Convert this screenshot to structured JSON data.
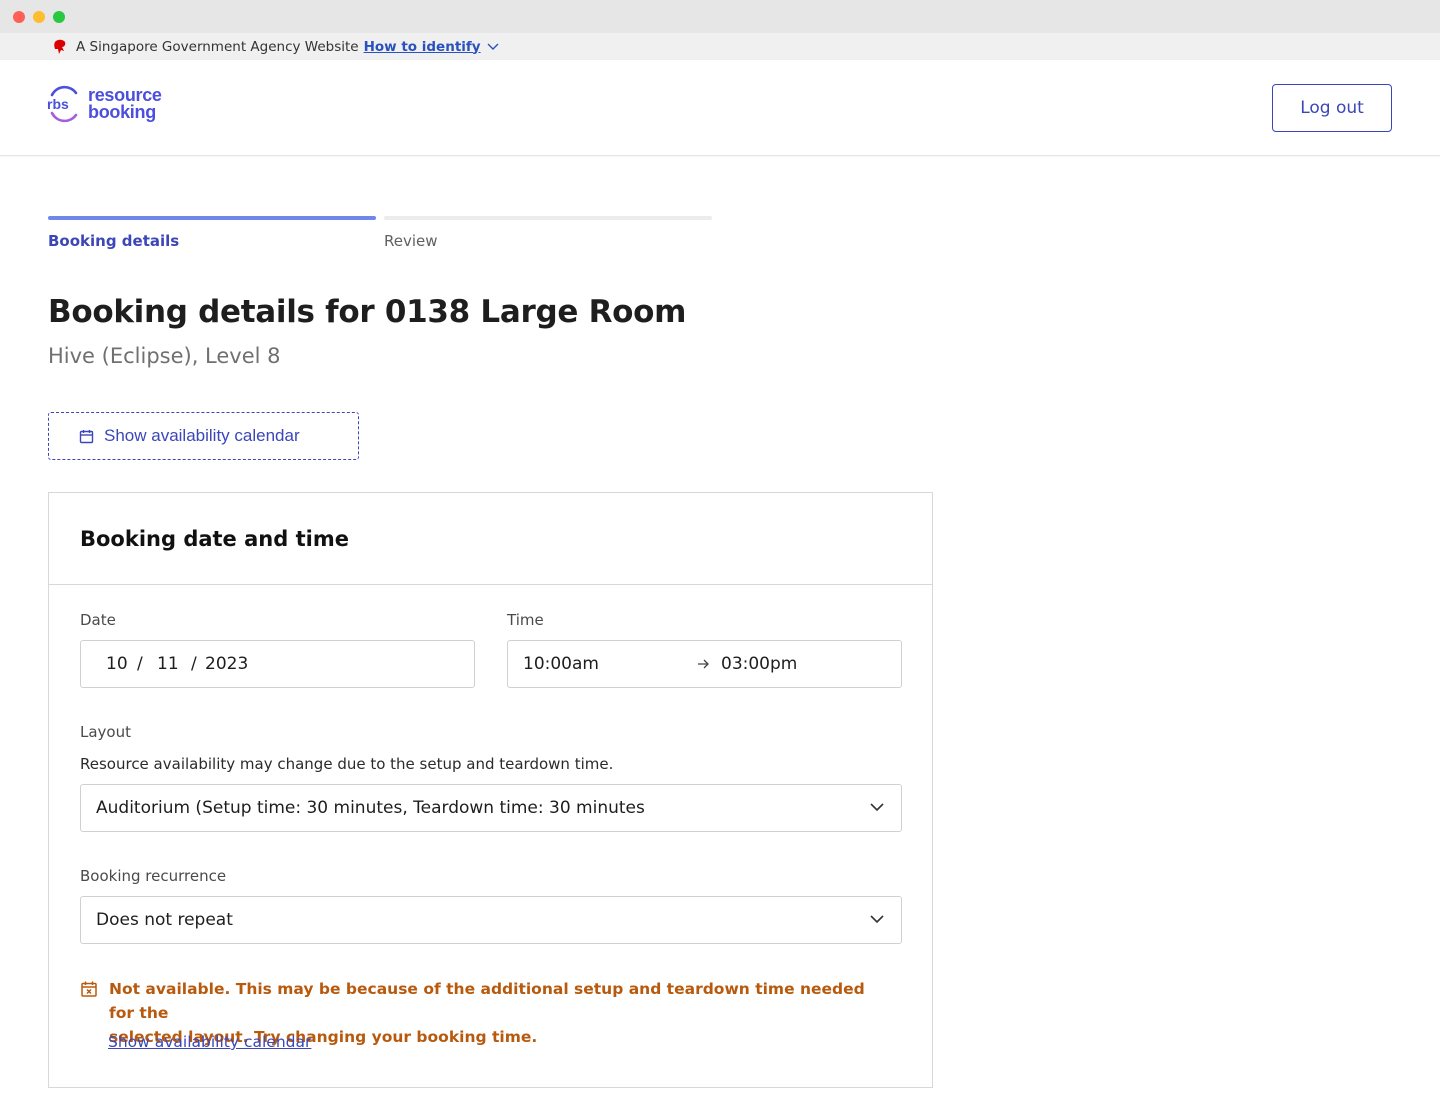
{
  "window": {
    "controls": [
      "close",
      "minimize",
      "maximize"
    ]
  },
  "masthead": {
    "icon": "lion-head-icon",
    "text": "A Singapore Government Agency Website",
    "link": "How to identify"
  },
  "header": {
    "logo_line1": "resource",
    "logo_line2": "booking",
    "logout_label": "Log out"
  },
  "steps": [
    {
      "label": "Booking details",
      "active": true
    },
    {
      "label": "Review",
      "active": false
    }
  ],
  "page": {
    "title": "Booking details for 0138 Large Room",
    "subtitle": "Hive (Eclipse), Level 8",
    "calendar_button": "Show availability calendar"
  },
  "card": {
    "title": "Booking date and time",
    "date": {
      "label": "Date",
      "day": "10",
      "month": "11",
      "year": "2023",
      "separator": "/"
    },
    "time": {
      "label": "Time",
      "start": "10:00am",
      "end": "03:00pm"
    },
    "layout": {
      "label": "Layout",
      "helper": "Resource availability may change due to the setup and teardown time.",
      "value": "Auditorium (Setup time: 30 minutes, Teardown time: 30 minutes"
    },
    "recurrence": {
      "label": "Booking recurrence",
      "value": "Does not repeat"
    },
    "warning": {
      "line1": "Not available. This may be because of the additional setup and teardown time needed for the",
      "line2": "selected layout. Try changing your booking time.",
      "link": "Show availability calendar"
    }
  },
  "colors": {
    "primary": "#3c46b8",
    "step_active_bar": "#6f86ea",
    "warning": "#b85a0d",
    "logo": "#4b4fdc"
  }
}
